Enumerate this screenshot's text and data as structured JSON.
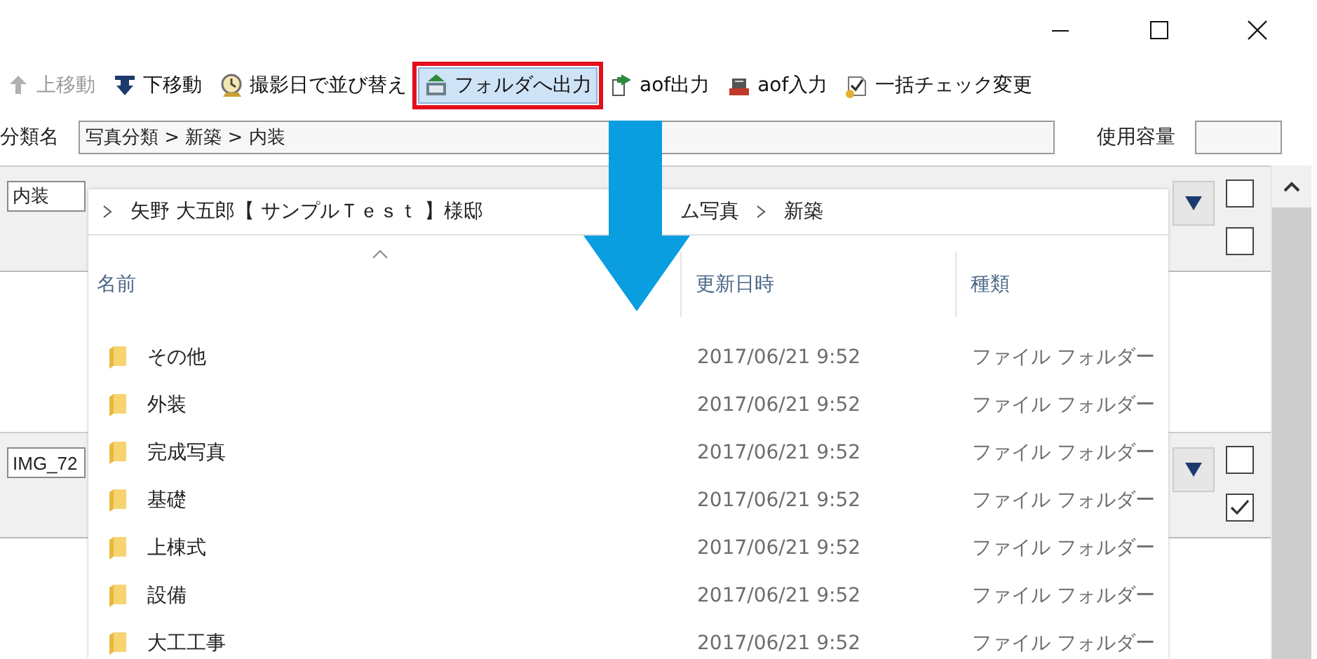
{
  "toolbar": [
    {
      "label": "上移動",
      "disabled": true,
      "highlighted": false
    },
    {
      "label": "下移動",
      "disabled": false,
      "highlighted": false
    },
    {
      "label": "撮影日で並び替え",
      "disabled": false,
      "highlighted": false
    },
    {
      "label": "フォルダへ出力",
      "disabled": false,
      "highlighted": true
    },
    {
      "label": "aof出力",
      "disabled": false,
      "highlighted": false
    },
    {
      "label": "aof入力",
      "disabled": false,
      "highlighted": false
    },
    {
      "label": "一括チェック変更",
      "disabled": false,
      "highlighted": false
    }
  ],
  "category": {
    "label": "分類名",
    "value": "写真分類 > 新築 > 内装",
    "usage_label": "使用容量"
  },
  "panels": [
    {
      "field": "内装",
      "checkboxes": [
        {
          "checked": false
        },
        {
          "checked": false
        }
      ]
    },
    {
      "field": "IMG_72",
      "checkboxes": [
        {
          "checked": false
        },
        {
          "checked": true
        }
      ]
    }
  ],
  "explorer": {
    "breadcrumb": [
      "矢野 大五郎【 サンプルＴｅｓｔ 】様邸",
      "ム写真",
      "新築"
    ],
    "columns": [
      "名前",
      "更新日時",
      "種類"
    ],
    "rows": [
      {
        "name": "その他",
        "modified": "2017/06/21 9:52",
        "type": "ファイル フォルダー"
      },
      {
        "name": "外装",
        "modified": "2017/06/21 9:52",
        "type": "ファイル フォルダー"
      },
      {
        "name": "完成写真",
        "modified": "2017/06/21 9:52",
        "type": "ファイル フォルダー"
      },
      {
        "name": "基礎",
        "modified": "2017/06/21 9:52",
        "type": "ファイル フォルダー"
      },
      {
        "name": "上棟式",
        "modified": "2017/06/21 9:52",
        "type": "ファイル フォルダー"
      },
      {
        "name": "設備",
        "modified": "2017/06/21 9:52",
        "type": "ファイル フォルダー"
      },
      {
        "name": "大工工事",
        "modified": "2017/06/21 9:52",
        "type": "ファイル フォルダー"
      }
    ]
  }
}
